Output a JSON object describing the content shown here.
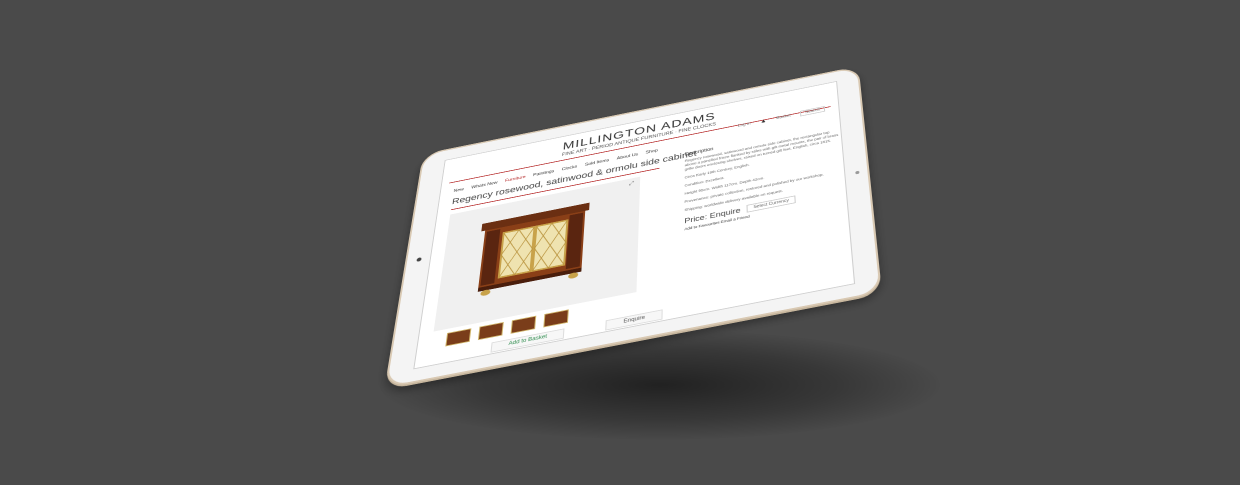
{
  "site": {
    "brand": "MILLINGTON ADAMS",
    "tagline": "FINE ART · PERIOD ANTIQUE FURNITURE · FINE CLOCKS"
  },
  "utility": {
    "login_label": "Log in",
    "cart_label": "Basket",
    "search_label": "Search"
  },
  "nav": {
    "items": [
      "New",
      "Whats New",
      "Furniture",
      "Paintings",
      "Clocks",
      "Sold Items",
      "About Us",
      "Shop"
    ]
  },
  "product": {
    "title": "Regency rosewood, satinwood & ormolu side cabinet",
    "description_heading": "Description",
    "description": "Regency rosewood, satinwood and ormolu side cabinet, the rectangular top above a panelled frieze flanked by stiles with gilt metal mounts, the pair of brass grille doors enclosing shelves, raised on turned gilt feet. English, circa 1815.",
    "note_1": "Circa Early 19th Century, English.",
    "note_2": "Condition: Excellent.",
    "note_3": "Height 95cm. Width 117cm. Depth 42cm.",
    "note_4": "Provenance: private collection, restored and polished by our workshop.",
    "note_5": "Shipping: worldwide delivery available on request.",
    "price": "Price: Enquire",
    "currency_label": "Select Currency",
    "share_label": "Add to Favourites  Email a Friend",
    "add_button": "Add to Basket",
    "enquire_button": "Enquire"
  }
}
